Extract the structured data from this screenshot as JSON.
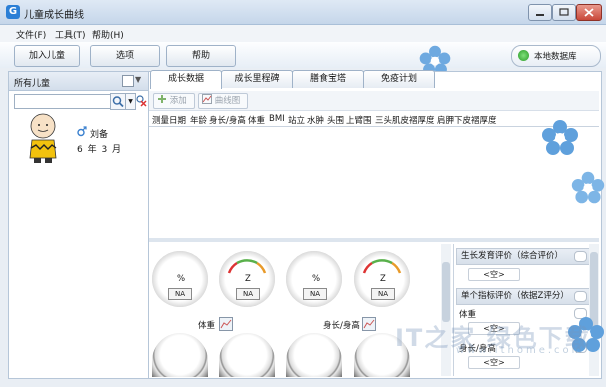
{
  "window": {
    "title": "儿童成长曲线",
    "app_icon_letter": "G"
  },
  "menu": [
    "文件(F)",
    "工具(T)",
    "帮助(H)"
  ],
  "toolbar": {
    "add_child": "加入儿童",
    "options": "选项",
    "help": "帮助",
    "db_status": "本地数据库",
    "db_status_color": "#3aaa35"
  },
  "left_panel": {
    "header": "所有儿童",
    "search_placeholder": "",
    "child": {
      "name": "刘备",
      "age": "6 年 3 月"
    }
  },
  "tabs": [
    "成长数据",
    "成长里程碑",
    "膳食宝塔",
    "免疫计划"
  ],
  "active_tab": "成长数据",
  "subtoolbar": {
    "add": "添加",
    "curve": "曲线图"
  },
  "table_columns": [
    "测量日期",
    "年龄",
    "身长/身高",
    "体重",
    "BMI",
    "站立",
    "水肿",
    "头围",
    "上臂围",
    "三头肌皮褶厚度",
    "肩胛下皮褶厚度"
  ],
  "gauges": {
    "na": "NA",
    "z_label": "Z",
    "pct_label": "%",
    "group1_label": "体重",
    "group2_label": "身长/身高",
    "ticks_pct": [
      "10",
      "20",
      "30",
      "40",
      "50",
      "60",
      "70",
      "80",
      "90",
      "100",
      "0"
    ],
    "ticks_z": [
      "-4",
      "-3",
      "-2",
      "-1",
      "0",
      "1",
      "2",
      "3",
      "4"
    ]
  },
  "evaluation": {
    "overall_head": "生长发育评价（综合评价）",
    "empty": "<空>",
    "single_head": "单个指标评价（依据Z评分）",
    "weight": "体重",
    "height": "身长/身高"
  },
  "watermark": {
    "main": "IT之家  绿色下载",
    "sub": "www.ithome.com"
  },
  "colors": {
    "accent": "#2b7fd6",
    "flower": "#5fa0dc"
  }
}
